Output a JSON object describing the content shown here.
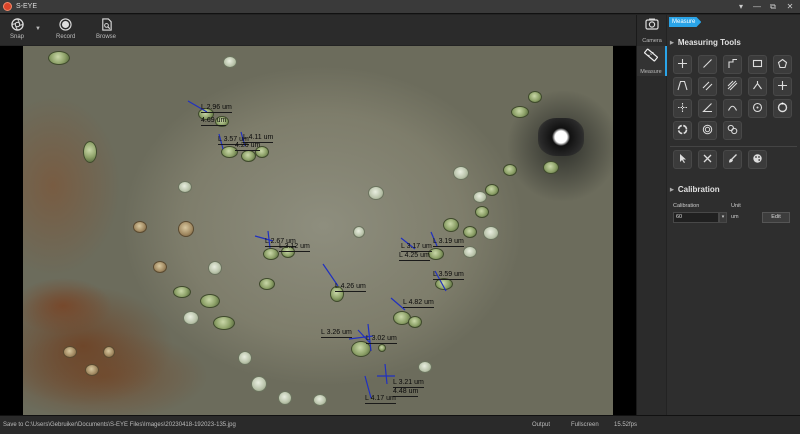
{
  "window": {
    "title": "S-EYE",
    "minimize": "—",
    "maximize": "▭",
    "restore": "⧉",
    "close": "✕",
    "menu": "▾"
  },
  "toolbar": {
    "snap_label": "Snap",
    "record_label": "Record",
    "browse_label": "Browse"
  },
  "modes": {
    "camera_label": "Camera",
    "measure_label": "Measure"
  },
  "panel": {
    "breadcrumb": "Measure",
    "measuring_tools_title": "Measuring Tools",
    "calibration_title": "Calibration",
    "calibration_label": "Calibration",
    "unit_label": "Unit",
    "calibration_value": "60",
    "unit_value": "um",
    "edit_label": "Edit"
  },
  "measurements": [
    "L 2.96 um",
    "4.69 um",
    "L 3.57 um",
    "L 4.11 um",
    "4.26 um",
    "L 2.67 um",
    "L 3.12 um",
    "L 3.17 um",
    "L 3.19 um",
    "L 4.25 um",
    "L 3.59 um",
    "L 4.26 um",
    "L 4.82 um",
    "L 3.26 um",
    "L 3.02 um",
    "L 3.21 um",
    "4.48 um",
    "L 4.17 um"
  ],
  "status": {
    "save_path": "Save to C:\\Users\\Gebruiker\\Documents\\S-EYE Files\\Images\\20230418-192023-135.jpg",
    "output_label": "Output",
    "fullscreen_label": "Fullscreen",
    "fps": "15.52fps"
  }
}
